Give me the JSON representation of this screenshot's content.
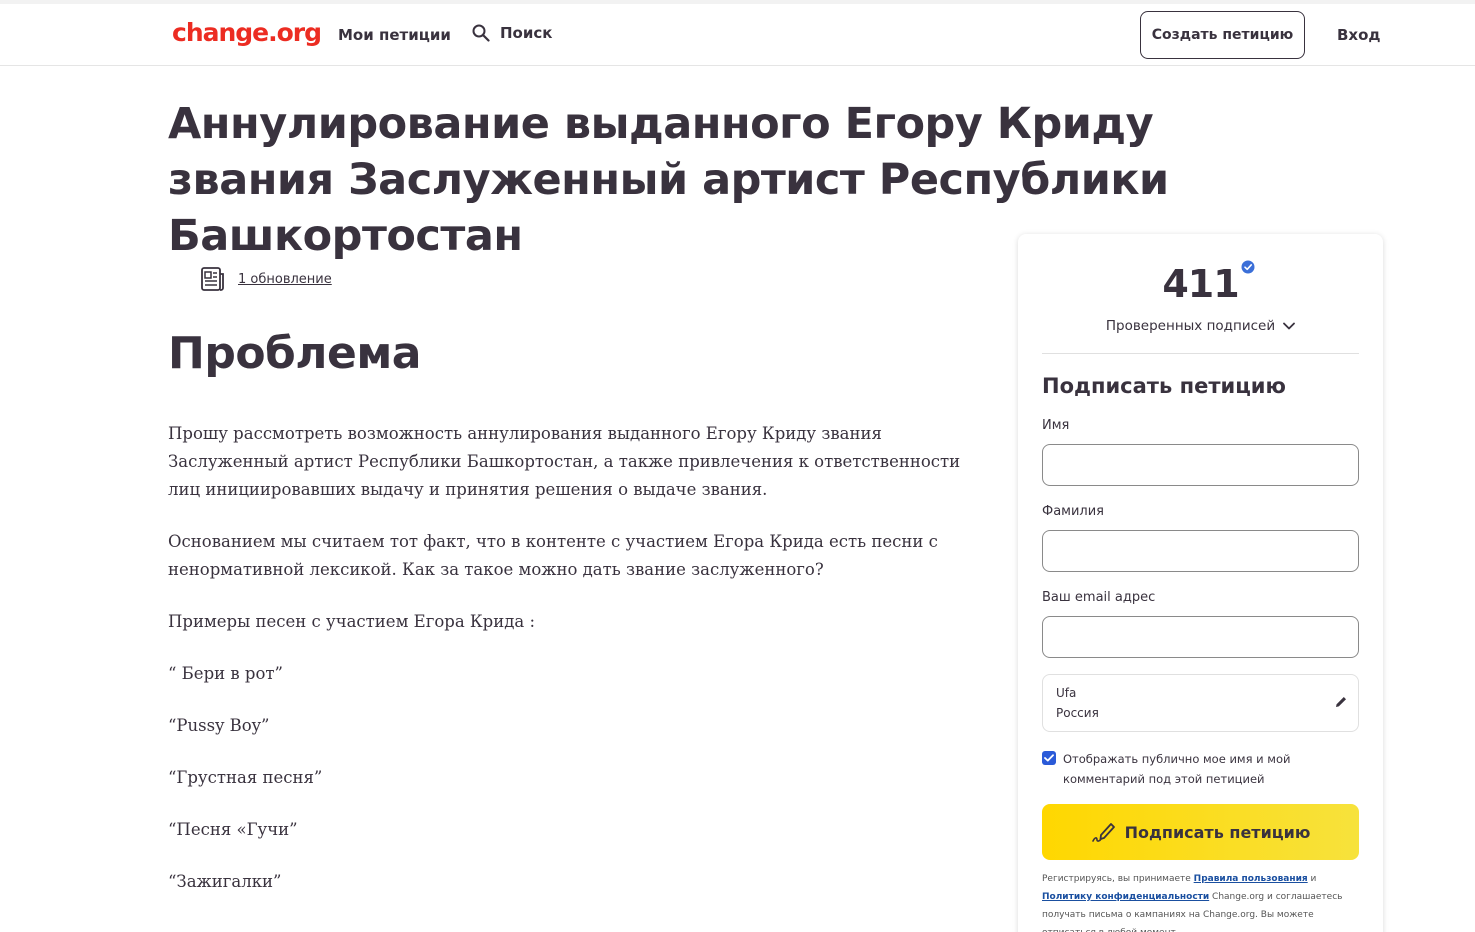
{
  "header": {
    "logo": "change.org",
    "my_petitions": "Мои петиции",
    "search": "Поиск",
    "create_petition": "Создать петицию",
    "login": "Вход"
  },
  "petition": {
    "title": "Аннулирование выданного Егору Криду звания Заслуженный артист Республики Башкортостан",
    "updates_link": "1 обновление",
    "section_title": "Проблема",
    "paragraphs": [
      "Прошу рассмотреть возможность аннулирования выданного Егору Криду звания Заслуженный артист Республики Башкортостан, а также привлечения к ответственности лиц инициировавших выдачу и принятия решения о выдаче звания.",
      "Основанием мы считаем тот факт, что в контенте с участием Егора Крида есть песни с ненормативной лексикой. Как за такое можно дать звание заслуженного?",
      "Примеры песен с участием Егора Крида :",
      "“ Бери в рот”",
      "“Pussy Boy”",
      "“Грустная песня”",
      "“Песня «Гучи”",
      "“Зажигалки”"
    ]
  },
  "signature_card": {
    "count": "411",
    "verified_label": "Проверенных подписей",
    "sign_title": "Подписать петицию",
    "first_name_label": "Имя",
    "first_name_value": "",
    "last_name_label": "Фамилия",
    "last_name_value": "",
    "email_label": "Ваш email адрес",
    "email_value": "",
    "location_city": "Ufa",
    "location_country": "Россия",
    "display_publicly": "Отображать публично мое имя и мой комментарий под этой петицией",
    "display_publicly_checked": true,
    "sign_button": "Подписать петицию",
    "legal_prefix": "Регистрируясь, вы принимаете ",
    "terms_link": "Правила пользования",
    "legal_and": " и ",
    "privacy_link": "Политику конфиденциальности",
    "legal_suffix": " Change.org и соглашаетесь получать письма о кампаниях на Change.org. Вы можете отписаться в любой момент."
  },
  "colors": {
    "brand": "#ec2c22",
    "text": "#39323e",
    "sign_button": "#ffd700",
    "checkbox": "#2a5ad8",
    "verified_badge": "#3b6fd8"
  }
}
